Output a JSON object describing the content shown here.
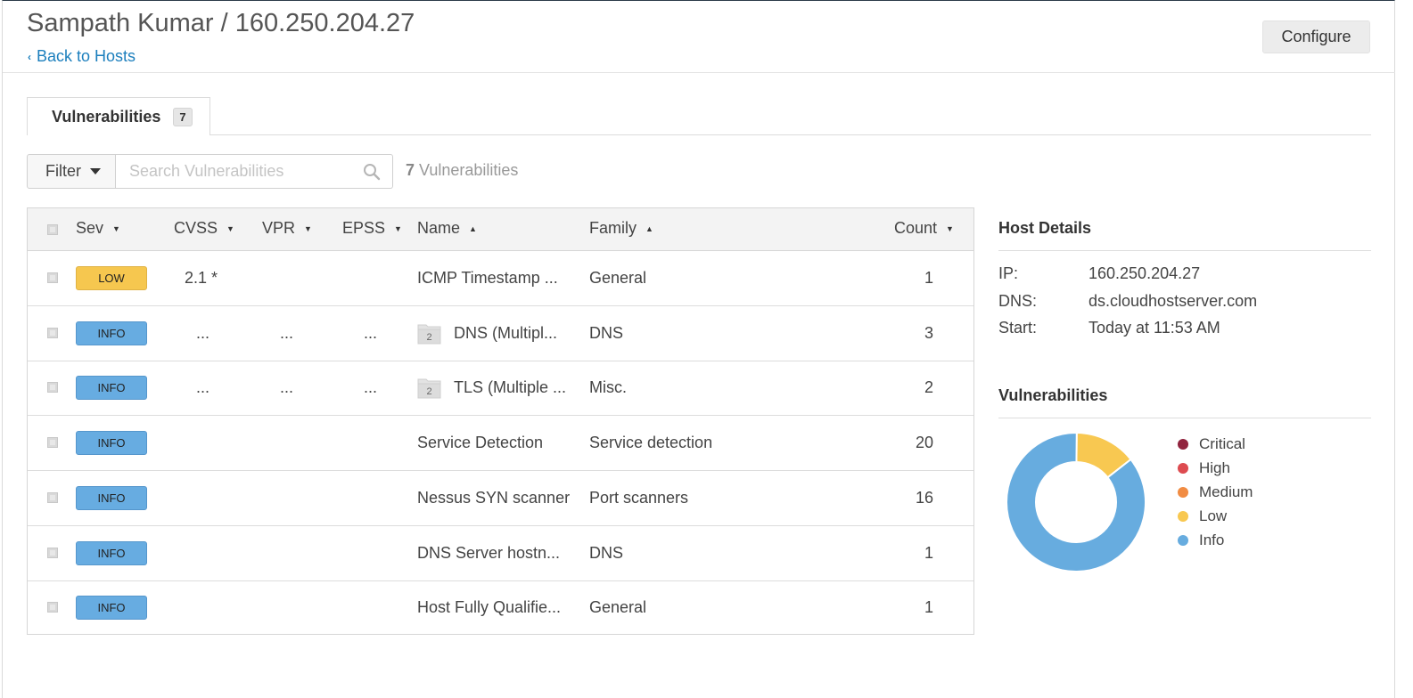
{
  "header": {
    "title": "Sampath Kumar / 160.250.204.27",
    "back_label": "Back to Hosts",
    "configure_label": "Configure"
  },
  "tabs": [
    {
      "label": "Vulnerabilities",
      "count": "7"
    }
  ],
  "toolbar": {
    "filter_label": "Filter",
    "search_placeholder": "Search Vulnerabilities",
    "count_number": "7",
    "count_label": "Vulnerabilities"
  },
  "table": {
    "columns": {
      "sev": "Sev",
      "cvss": "CVSS",
      "vpr": "VPR",
      "epss": "EPSS",
      "name": "Name",
      "family": "Family",
      "count": "Count"
    },
    "rows": [
      {
        "sev": "LOW",
        "cvss": "2.1 *",
        "vpr": "",
        "epss": "",
        "group": "",
        "name": "ICMP Timestamp ...",
        "family": "General",
        "count": "1"
      },
      {
        "sev": "INFO",
        "cvss": "...",
        "vpr": "...",
        "epss": "...",
        "group": "2",
        "name": "DNS (Multipl...",
        "family": "DNS",
        "count": "3"
      },
      {
        "sev": "INFO",
        "cvss": "...",
        "vpr": "...",
        "epss": "...",
        "group": "2",
        "name": "TLS (Multiple ...",
        "family": "Misc.",
        "count": "2"
      },
      {
        "sev": "INFO",
        "cvss": "",
        "vpr": "",
        "epss": "",
        "group": "",
        "name": "Service Detection",
        "family": "Service detection",
        "count": "20"
      },
      {
        "sev": "INFO",
        "cvss": "",
        "vpr": "",
        "epss": "",
        "group": "",
        "name": "Nessus SYN scanner",
        "family": "Port scanners",
        "count": "16"
      },
      {
        "sev": "INFO",
        "cvss": "",
        "vpr": "",
        "epss": "",
        "group": "",
        "name": "DNS Server hostn...",
        "family": "DNS",
        "count": "1"
      },
      {
        "sev": "INFO",
        "cvss": "",
        "vpr": "",
        "epss": "",
        "group": "",
        "name": "Host Fully Qualifie...",
        "family": "General",
        "count": "1"
      }
    ]
  },
  "host_details": {
    "title": "Host Details",
    "ip_label": "IP:",
    "ip_value": "160.250.204.27",
    "dns_label": "DNS:",
    "dns_value": "ds.cloudhostserver.com",
    "start_label": "Start:",
    "start_value": "Today at 11:53 AM"
  },
  "vulnerabilities_panel": {
    "title": "Vulnerabilities",
    "legend": [
      {
        "label": "Critical",
        "color": "#91243e"
      },
      {
        "label": "High",
        "color": "#dd4b50"
      },
      {
        "label": "Medium",
        "color": "#f18c43"
      },
      {
        "label": "Low",
        "color": "#f8c851"
      },
      {
        "label": "Info",
        "color": "#67acdf"
      }
    ]
  },
  "chart_data": {
    "type": "pie",
    "categories": [
      "Critical",
      "High",
      "Medium",
      "Low",
      "Info"
    ],
    "values": [
      0,
      0,
      0,
      1,
      6
    ],
    "colors": [
      "#91243e",
      "#dd4b50",
      "#f18c43",
      "#f8c851",
      "#67acdf"
    ]
  }
}
